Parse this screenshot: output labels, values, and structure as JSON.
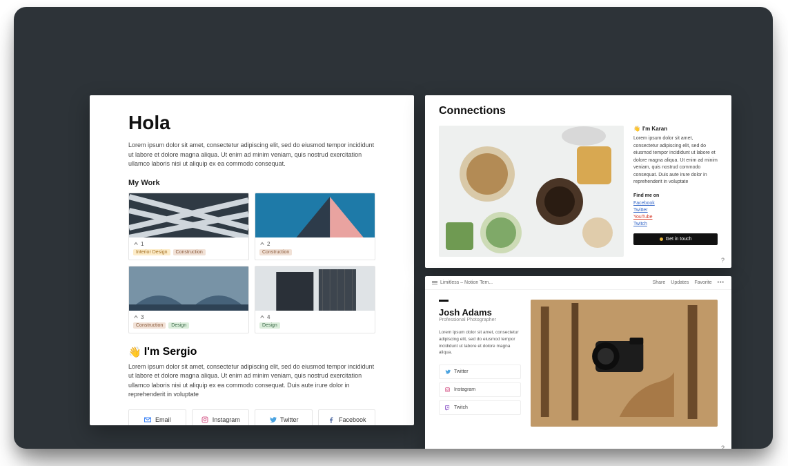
{
  "left": {
    "title": "Hola",
    "intro": "Lorem ipsum dolor sit amet, consectetur adipiscing elit, sed do eiusmod tempor incididunt ut labore et dolore magna aliqua. Ut enim ad minim veniam, quis nostrud exercitation ullamco laboris nisi ut aliquip ex ea commodo consequat.",
    "work_heading": "My Work",
    "items": [
      {
        "num": "1",
        "tags": [
          "Interior Design",
          "Construction"
        ]
      },
      {
        "num": "2",
        "tags": [
          "Construction"
        ]
      },
      {
        "num": "3",
        "tags": [
          "Construction",
          "Design"
        ]
      },
      {
        "num": "4",
        "tags": [
          "Design"
        ]
      }
    ],
    "sergio_heading": "I'm Sergio",
    "sergio_text": "Lorem ipsum dolor sit amet, consectetur adipiscing elit, sed do eiusmod tempor incididunt ut labore et dolore magna aliqua. Ut enim ad minim veniam, quis nostrud exercitation ullamco laboris nisi ut aliquip ex ea commodo consequat. Duis aute irure dolor in reprehenderit in voluptate",
    "contacts": {
      "email": "Email",
      "instagram": "Instagram",
      "twitter": "Twitter",
      "facebook": "Facebook"
    }
  },
  "tr": {
    "title": "Connections",
    "karan_heading": "I'm Karan",
    "karan_text": "Lorem ipsum dolor sit amet, consectetur adipiscing elit, sed do eiusmod tempor incididunt ut labore et dolore magna aliqua. Ut enim ad minim veniam, quis nostrud commodo consequat. Duis aute irure dolor in reprehenderit in voluptate",
    "findme": "Find me on",
    "links": {
      "facebook": "Facebook",
      "twitter": "Twitter",
      "youtube": "YouTube",
      "twitch": "Twitch"
    },
    "cta": "Get in touch",
    "help": "?"
  },
  "br": {
    "breadcrumb": "Limitless – Notion Tem...",
    "nav": {
      "share": "Share",
      "updates": "Updates",
      "favorite": "Favorite"
    },
    "name": "Josh Adams",
    "role": "Professional Photographer",
    "text": "Lorem ipsum dolor sit amet, consectetur adipiscing elit, sed do eiusmod tempor incididunt ut labore et dolore magna aliqua.",
    "socials": {
      "twitter": "Twitter",
      "instagram": "Instagram",
      "twitch": "Twitch"
    },
    "help": "?"
  }
}
